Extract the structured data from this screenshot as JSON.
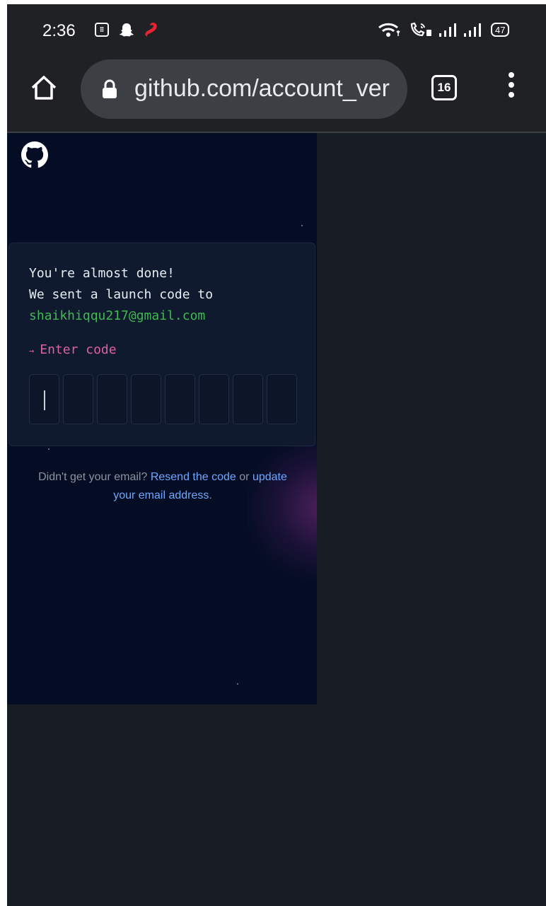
{
  "status_bar": {
    "time": "2:36",
    "battery": "47"
  },
  "browser": {
    "url": "github.com/account_ver",
    "tab_count": "16"
  },
  "card": {
    "line1": "You're almost done!",
    "line2": "We sent a launch code to",
    "email": "shaikhiqqu217@gmail.com",
    "arrow": "→",
    "enter_label": "Enter code",
    "code_boxes": 8
  },
  "resend": {
    "prefix": "Didn't get your email?",
    "resend_link": "Resend the code",
    "middle": "or",
    "update_link_1": "update",
    "update_link_2": "your email address",
    "suffix": "."
  },
  "colors": {
    "page_bg": "#050d24",
    "email_green": "#3fb950",
    "enter_pink": "#db61a2",
    "link_blue": "#6ea8fe"
  }
}
